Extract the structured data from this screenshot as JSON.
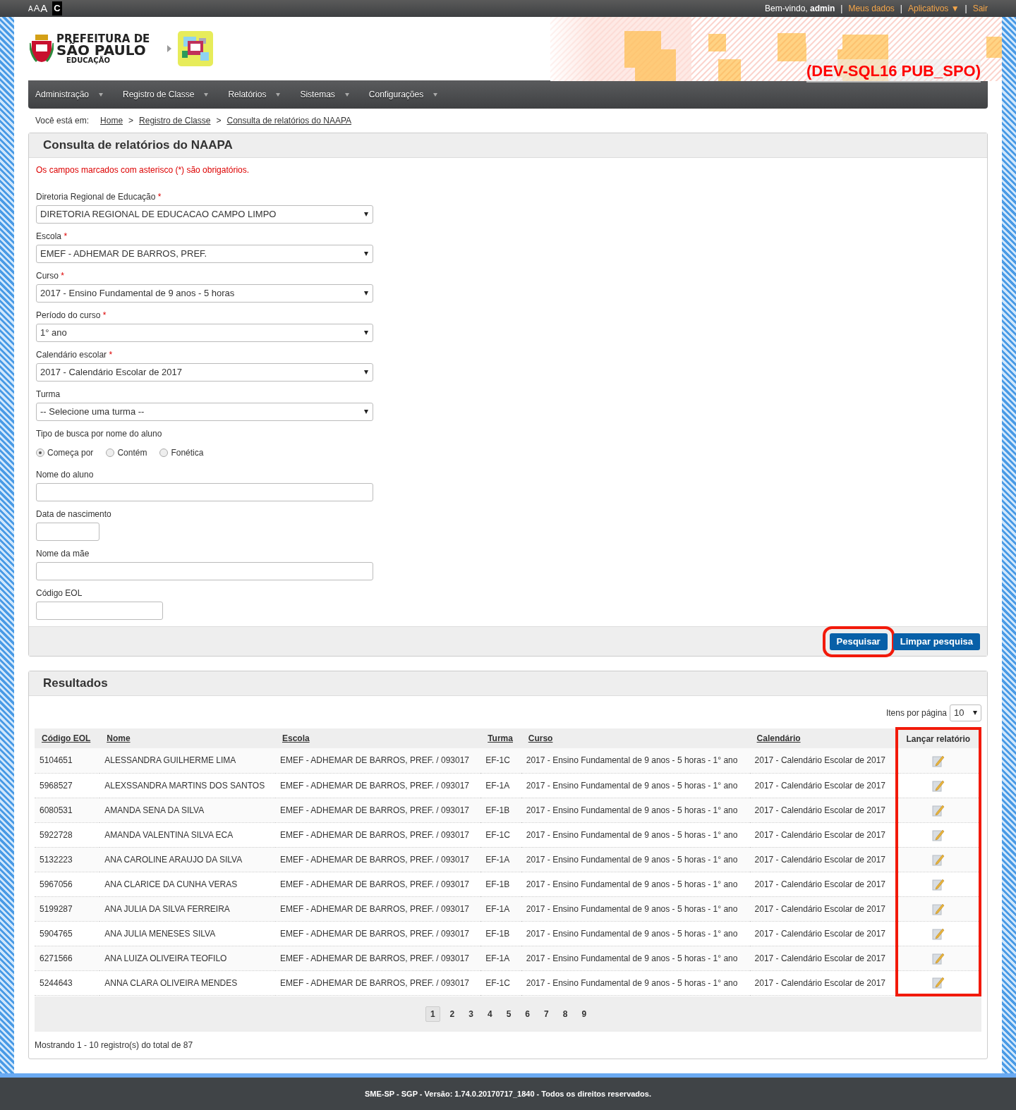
{
  "top_bar": {
    "font_sizes": [
      "A",
      "A",
      "A"
    ],
    "contrast": "C",
    "items": [
      {
        "kind": "text",
        "text": "Bem-vindo, **admin**"
      },
      {
        "kind": "sep",
        "text": "|"
      },
      {
        "kind": "link",
        "text": "Meus dados"
      },
      {
        "kind": "sep",
        "text": "|"
      },
      {
        "kind": "link",
        "text": "Aplicativos ▼"
      },
      {
        "kind": "sep",
        "text": "|"
      },
      {
        "kind": "link",
        "text": "Sair"
      }
    ]
  },
  "header": {
    "logo_lines": [
      "PREFEITURA DE",
      "SÃO PAULO",
      "EDUCAÇÃO"
    ],
    "environment": "(DEV-SQL16 PUB_SPO)"
  },
  "nav": [
    "Administração",
    "Registro de Classe",
    "Relatórios",
    "Sistemas",
    "Configurações"
  ],
  "breadcrumb": {
    "label": "Você está em:",
    "items": [
      {
        "kind": "link",
        "text": "Home"
      },
      {
        "kind": "sep",
        "text": ">"
      },
      {
        "kind": "link",
        "text": "Registro de Classe"
      },
      {
        "kind": "sep",
        "text": ">"
      },
      {
        "kind": "link",
        "text": "Consulta de relatórios do NAAPA"
      }
    ]
  },
  "search_panel": {
    "title": "Consulta de relatórios do NAAPA",
    "required_note": "Os campos marcados com asterisco (*) são obrigatórios.",
    "required_mark": "*",
    "fields": [
      {
        "kind": "select",
        "label": "Diretoria Regional de Educação",
        "required": true,
        "value": "DIRETORIA REGIONAL DE EDUCACAO CAMPO LIMPO"
      },
      {
        "kind": "select",
        "label": "Escola",
        "required": true,
        "value": "EMEF - ADHEMAR DE BARROS, PREF."
      },
      {
        "kind": "select",
        "label": "Curso",
        "required": true,
        "value": "2017 - Ensino Fundamental de 9 anos - 5 horas"
      },
      {
        "kind": "select",
        "label": "Período do curso",
        "required": true,
        "value": "1° ano"
      },
      {
        "kind": "select",
        "label": "Calendário escolar",
        "required": true,
        "value": "2017 - Calendário Escolar de 2017"
      },
      {
        "kind": "select",
        "label": "Turma",
        "required": false,
        "value": "-- Selecione uma turma --"
      },
      {
        "kind": "radio",
        "label": "Tipo de busca por nome do aluno",
        "required": false,
        "options": [
          {
            "label": "Começa por",
            "selected": true
          },
          {
            "label": "Contém",
            "selected": false
          },
          {
            "label": "Fonética",
            "selected": false
          }
        ]
      },
      {
        "kind": "text",
        "label": "Nome do aluno",
        "required": false
      },
      {
        "kind": "date",
        "label": "Data de nascimento",
        "required": false
      },
      {
        "kind": "text",
        "label": "Nome da mãe",
        "required": false
      },
      {
        "kind": "code",
        "label": "Código EOL",
        "required": false
      }
    ],
    "buttons": [
      {
        "label": "Pesquisar",
        "highlighted": true
      },
      {
        "label": "Limpar pesquisa",
        "highlighted": false
      }
    ]
  },
  "results": {
    "title": "Resultados",
    "page_size_label": "Itens por página",
    "page_size": "10",
    "columns": [
      {
        "label": "Código EOL",
        "sortable": true,
        "highlighted": false
      },
      {
        "label": "Nome",
        "sortable": true,
        "highlighted": false
      },
      {
        "label": "Escola",
        "sortable": true,
        "highlighted": false
      },
      {
        "label": "Turma",
        "sortable": true,
        "highlighted": false
      },
      {
        "label": "Curso",
        "sortable": true,
        "highlighted": false
      },
      {
        "label": "Calendário",
        "sortable": true,
        "highlighted": false
      },
      {
        "label": "Lançar relatório",
        "sortable": false,
        "highlighted": true
      }
    ],
    "rows": [
      [
        "5104651",
        "ALESSANDRA GUILHERME LIMA",
        "EMEF - ADHEMAR DE BARROS, PREF. / 093017",
        "EF-1C",
        "2017 - Ensino Fundamental de 9 anos - 5 horas - 1° ano",
        "2017 - Calendário Escolar de 2017"
      ],
      [
        "5968527",
        "ALEXSSANDRA MARTINS DOS SANTOS",
        "EMEF - ADHEMAR DE BARROS, PREF. / 093017",
        "EF-1A",
        "2017 - Ensino Fundamental de 9 anos - 5 horas - 1° ano",
        "2017 - Calendário Escolar de 2017"
      ],
      [
        "6080531",
        "AMANDA SENA DA SILVA",
        "EMEF - ADHEMAR DE BARROS, PREF. / 093017",
        "EF-1B",
        "2017 - Ensino Fundamental de 9 anos - 5 horas - 1° ano",
        "2017 - Calendário Escolar de 2017"
      ],
      [
        "5922728",
        "AMANDA VALENTINA SILVA ECA",
        "EMEF - ADHEMAR DE BARROS, PREF. / 093017",
        "EF-1C",
        "2017 - Ensino Fundamental de 9 anos - 5 horas - 1° ano",
        "2017 - Calendário Escolar de 2017"
      ],
      [
        "5132223",
        "ANA CAROLINE ARAUJO DA SILVA",
        "EMEF - ADHEMAR DE BARROS, PREF. / 093017",
        "EF-1A",
        "2017 - Ensino Fundamental de 9 anos - 5 horas - 1° ano",
        "2017 - Calendário Escolar de 2017"
      ],
      [
        "5967056",
        "ANA CLARICE DA CUNHA VERAS",
        "EMEF - ADHEMAR DE BARROS, PREF. / 093017",
        "EF-1B",
        "2017 - Ensino Fundamental de 9 anos - 5 horas - 1° ano",
        "2017 - Calendário Escolar de 2017"
      ],
      [
        "5199287",
        "ANA JULIA DA SILVA FERREIRA",
        "EMEF - ADHEMAR DE BARROS, PREF. / 093017",
        "EF-1A",
        "2017 - Ensino Fundamental de 9 anos - 5 horas - 1° ano",
        "2017 - Calendário Escolar de 2017"
      ],
      [
        "5904765",
        "ANA JULIA MENESES SILVA",
        "EMEF - ADHEMAR DE BARROS, PREF. / 093017",
        "EF-1B",
        "2017 - Ensino Fundamental de 9 anos - 5 horas - 1° ano",
        "2017 - Calendário Escolar de 2017"
      ],
      [
        "6271566",
        "ANA LUIZA OLIVEIRA TEOFILO",
        "EMEF - ADHEMAR DE BARROS, PREF. / 093017",
        "EF-1A",
        "2017 - Ensino Fundamental de 9 anos - 5 horas - 1° ano",
        "2017 - Calendário Escolar de 2017"
      ],
      [
        "5244643",
        "ANNA CLARA OLIVEIRA MENDES",
        "EMEF - ADHEMAR DE BARROS, PREF. / 093017",
        "EF-1C",
        "2017 - Ensino Fundamental de 9 anos - 5 horas - 1° ano",
        "2017 - Calendário Escolar de 2017"
      ]
    ],
    "pages": [
      {
        "label": "1",
        "selected": true
      },
      {
        "label": "2",
        "selected": false
      },
      {
        "label": "3",
        "selected": false
      },
      {
        "label": "4",
        "selected": false
      },
      {
        "label": "5",
        "selected": false
      },
      {
        "label": "6",
        "selected": false
      },
      {
        "label": "7",
        "selected": false
      },
      {
        "label": "8",
        "selected": false
      },
      {
        "label": "9",
        "selected": false
      }
    ],
    "summary": "Mostrando 1 - 10 registro(s) do total de 87"
  },
  "footer": "SME-SP - SGP - Versão: 1.74.0.20170717_1840 - Todos os direitos reservados."
}
